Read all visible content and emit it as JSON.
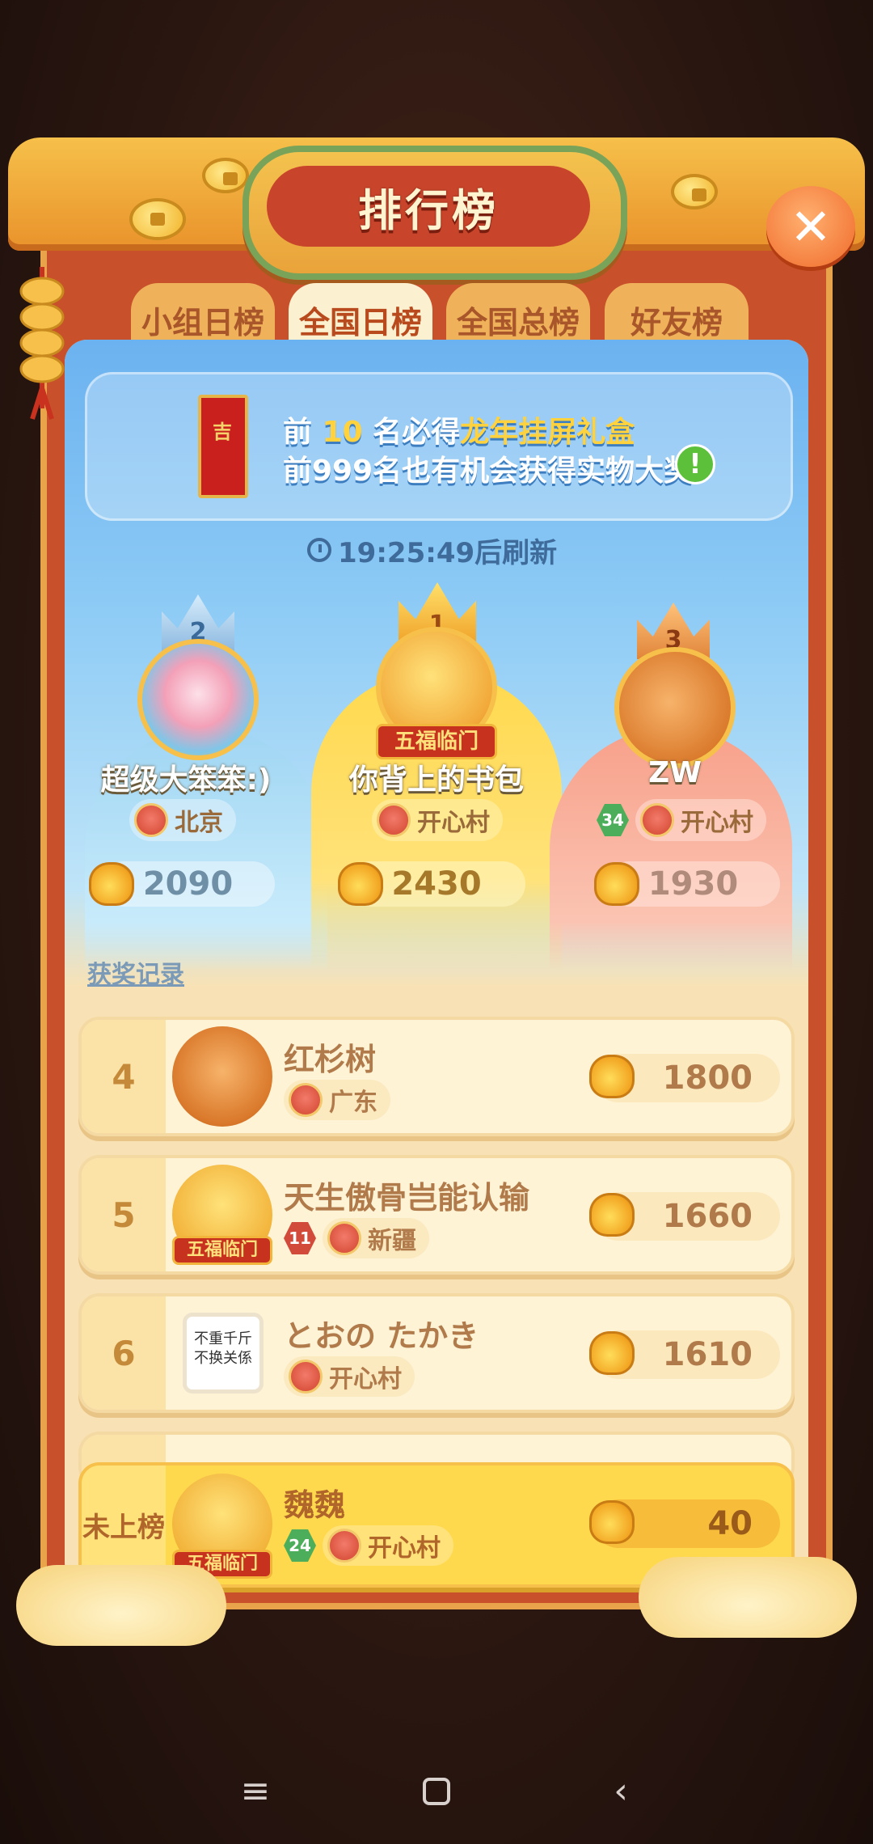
{
  "title": "排行榜",
  "tabs": [
    {
      "label": "小组日榜",
      "active": false
    },
    {
      "label": "全国日榜",
      "active": true
    },
    {
      "label": "全国总榜",
      "active": false
    },
    {
      "label": "好友榜",
      "active": false
    }
  ],
  "banner": {
    "line1_prefix": "前",
    "line1_rank": "10",
    "line1_mid": "名必得",
    "line1_prize": "龙年挂屏礼盒",
    "line2": "前999名也有机会获得实物大奖"
  },
  "refresh_text": "19:25:49后刷新",
  "top3": [
    {
      "rank": "2",
      "name": "超级大笨笨:)",
      "location": "北京",
      "score": "2090"
    },
    {
      "rank": "1",
      "name": "你背上的书包",
      "location": "开心村",
      "score": "2430",
      "badge": "五福临门"
    },
    {
      "rank": "3",
      "name": "ZW",
      "level": "34",
      "location": "开心村",
      "score": "1930"
    }
  ],
  "award_record": "获奖记录",
  "list": [
    {
      "rank": "4",
      "name": "红杉树",
      "location": "广东",
      "score": "1800"
    },
    {
      "rank": "5",
      "name": "天生傲骨岂能认输",
      "level": "11",
      "location": "新疆",
      "score": "1660",
      "badge": "五福临门"
    },
    {
      "rank": "6",
      "name": "とおの たかき",
      "location": "开心村",
      "score": "1610",
      "photo_text": "不重千斤 不换关係"
    }
  ],
  "self": {
    "rank": "未上榜",
    "name": "魏魏",
    "level": "24",
    "location": "开心村",
    "score": "40",
    "badge": "五福临门"
  },
  "colors": {
    "frame": "#c8502a",
    "gold": "#ffd23e",
    "sky": "#6bb2f0",
    "row_bg": "#fff3d6",
    "self_bg": "#ffd94d"
  }
}
